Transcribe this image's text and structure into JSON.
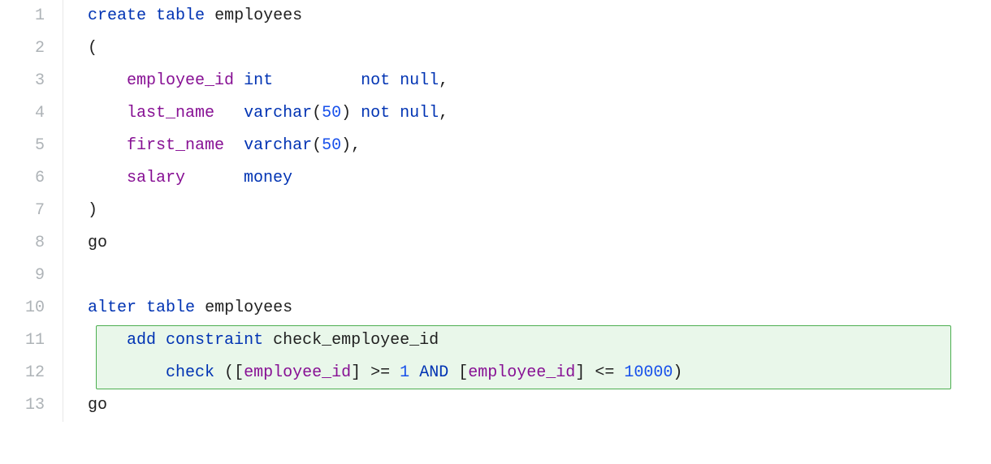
{
  "gutter": {
    "lines": [
      "1",
      "2",
      "3",
      "4",
      "5",
      "6",
      "7",
      "8",
      "9",
      "10",
      "11",
      "12",
      "13"
    ]
  },
  "code": {
    "l1": {
      "kw_create": "create",
      "kw_table": "table",
      "tbl": "employees"
    },
    "l2": {
      "paren": "("
    },
    "l3": {
      "col": "employee_id",
      "type": "int",
      "nn": "not null",
      "comma": ","
    },
    "l4": {
      "col": "last_name",
      "type": "varchar",
      "lp": "(",
      "n": "50",
      "rp": ")",
      "nn": "not null",
      "comma": ","
    },
    "l5": {
      "col": "first_name",
      "type": "varchar",
      "lp": "(",
      "n": "50",
      "rp": ")",
      "comma": ","
    },
    "l6": {
      "col": "salary",
      "type": "money"
    },
    "l7": {
      "paren": ")"
    },
    "l8": {
      "go": "go"
    },
    "l10": {
      "kw_alter": "alter",
      "kw_table": "table",
      "tbl": "employees"
    },
    "l11": {
      "kw_add": "add",
      "kw_constraint": "constraint",
      "name": "check_employee_id"
    },
    "l12": {
      "kw_check": "check",
      "lp": "(",
      "lb1": "[",
      "col1": "employee_id",
      "rb1": "]",
      "op1": ">=",
      "n1": "1",
      "kw_and": "AND",
      "lb2": "[",
      "col2": "employee_id",
      "rb2": "]",
      "op2": "<=",
      "n2": "10000",
      "rp": ")"
    },
    "l13": {
      "go": "go"
    }
  },
  "highlight": {
    "startLine": 11,
    "endLine": 12
  }
}
